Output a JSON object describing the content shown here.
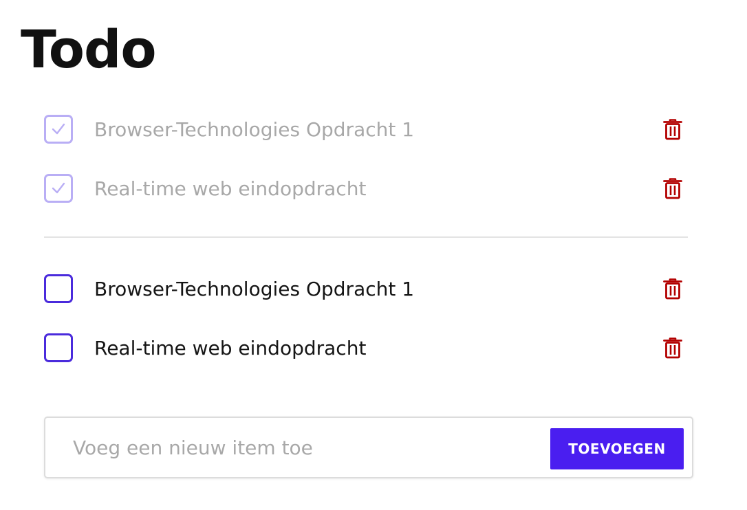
{
  "header": {
    "title": "Todo"
  },
  "completed_items": [
    {
      "label": "Browser-Technologies Opdracht 1",
      "checked": true,
      "delete_icon": "trash-icon"
    },
    {
      "label": "Real-time web eindopdracht",
      "checked": true,
      "delete_icon": "trash-icon"
    }
  ],
  "open_items": [
    {
      "label": "Browser-Technologies Opdracht 1",
      "checked": false,
      "delete_icon": "trash-icon"
    },
    {
      "label": "Real-time web eindopdracht",
      "checked": false,
      "delete_icon": "trash-icon"
    }
  ],
  "add_form": {
    "input_value": "",
    "input_placeholder": "Voeg een nieuw item toe",
    "button_label": "TOEVOEGEN"
  },
  "colors": {
    "accent": "#4a1ef0",
    "checkbox_border": "#4a2bdc",
    "checkbox_done_border": "#b9aef5",
    "delete_red": "#b30000",
    "done_text": "#a8a8a8",
    "text": "#151515"
  }
}
